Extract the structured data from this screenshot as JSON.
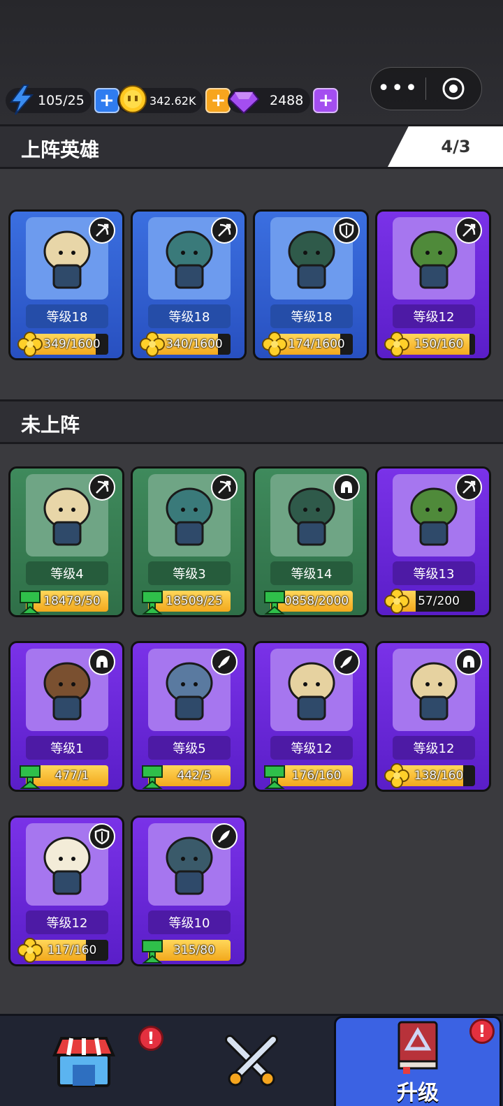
{
  "resources": {
    "energy": {
      "value": "105/25",
      "icon": "lightning-icon",
      "color": "#3a8cf0"
    },
    "coins": {
      "value": "342.62K",
      "icon": "coin-icon",
      "color": "#ffc820"
    },
    "gems": {
      "value": "2488",
      "icon": "gem-icon",
      "color": "#a44ef0"
    }
  },
  "deployed": {
    "title": "上阵英雄",
    "count": "4/3",
    "heroes": [
      {
        "level": "等级18",
        "progress": "349/1600",
        "fill": 0.85,
        "rarity": "blue",
        "role": "bow-icon",
        "currency": "clover-icon"
      },
      {
        "level": "等级18",
        "progress": "340/1600",
        "fill": 0.85,
        "rarity": "blue",
        "role": "bow-icon",
        "currency": "clover-icon"
      },
      {
        "level": "等级18",
        "progress": "174/1600",
        "fill": 0.85,
        "rarity": "blue",
        "role": "shield-icon",
        "currency": "clover-icon"
      },
      {
        "level": "等级12",
        "progress": "150/160",
        "fill": 0.93,
        "rarity": "purple",
        "role": "bow-icon",
        "currency": "clover-icon"
      }
    ]
  },
  "reserve": {
    "title": "未上阵",
    "heroes": [
      {
        "level": "等级4",
        "progress": "18479/50",
        "fill": 1.0,
        "rarity": "green",
        "role": "bow-icon",
        "currency": "trophy-icon"
      },
      {
        "level": "等级3",
        "progress": "18509/25",
        "fill": 1.0,
        "rarity": "green",
        "role": "bow-icon",
        "currency": "trophy-icon"
      },
      {
        "level": "等级14",
        "progress": "0858/2000",
        "fill": 1.0,
        "rarity": "green",
        "role": "helmet-icon",
        "currency": "trophy-icon"
      },
      {
        "level": "等级13",
        "progress": "57/200",
        "fill": 0.28,
        "rarity": "purple",
        "role": "bow-icon",
        "currency": "clover-icon"
      },
      {
        "level": "等级1",
        "progress": "477/1",
        "fill": 1.0,
        "rarity": "purple",
        "role": "helmet-icon",
        "currency": "trophy-icon"
      },
      {
        "level": "等级5",
        "progress": "442/5",
        "fill": 1.0,
        "rarity": "purple",
        "role": "sword-icon",
        "currency": "trophy-icon"
      },
      {
        "level": "等级12",
        "progress": "176/160",
        "fill": 1.0,
        "rarity": "purple",
        "role": "sword-icon",
        "currency": "trophy-icon"
      },
      {
        "level": "等级12",
        "progress": "138/160",
        "fill": 0.86,
        "rarity": "purple",
        "role": "helmet-icon",
        "currency": "clover-icon"
      },
      {
        "level": "等级12",
        "progress": "117/160",
        "fill": 0.73,
        "rarity": "purple",
        "role": "shield-icon",
        "currency": "clover-icon"
      },
      {
        "level": "等级10",
        "progress": "315/80",
        "fill": 1.0,
        "rarity": "purple",
        "role": "sword-icon",
        "currency": "trophy-icon"
      }
    ]
  },
  "nav": {
    "tabs": [
      {
        "name": "shop-tab",
        "icon": "shop-icon",
        "label": "",
        "alert": "!"
      },
      {
        "name": "battle-tab",
        "icon": "crossed-swords-icon",
        "label": ""
      },
      {
        "name": "upgrade-tab",
        "icon": "upgrade-book-icon",
        "label": "升级",
        "alert": "!"
      }
    ]
  }
}
